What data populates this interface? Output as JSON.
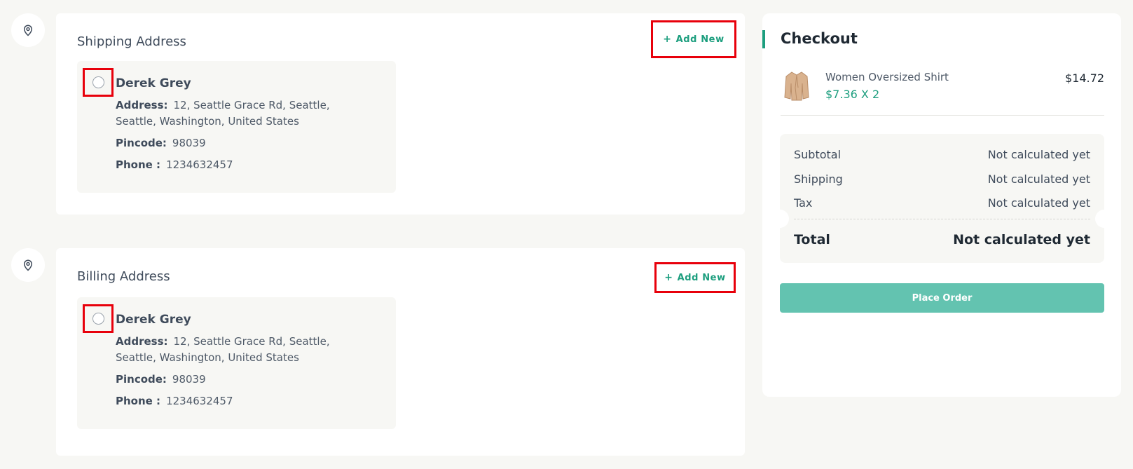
{
  "shipping": {
    "title": "Shipping Address",
    "add_new_label": "Add New",
    "address": {
      "name": "Derek Grey",
      "address_label": "Address:",
      "address_line1": "12, Seattle Grace Rd, Seattle,",
      "address_line2": "Seattle, Washington, United States",
      "pincode_label": "Pincode:",
      "pincode": "98039",
      "phone_label": "Phone :",
      "phone": "1234632457"
    }
  },
  "billing": {
    "title": "Billing Address",
    "add_new_label": "Add New",
    "address": {
      "name": "Derek Grey",
      "address_label": "Address:",
      "address_line1": "12, Seattle Grace Rd, Seattle,",
      "address_line2": "Seattle, Washington, United States",
      "pincode_label": "Pincode:",
      "pincode": "98039",
      "phone_label": "Phone :",
      "phone": "1234632457"
    }
  },
  "checkout": {
    "title": "Checkout",
    "item": {
      "name": "Women Oversized Shirt",
      "price_qty": "$7.36 X 2",
      "total": "$14.72",
      "thumbnail_icon": "shirt-thumbnail"
    },
    "summary": [
      {
        "label": "Subtotal",
        "value": "Not calculated yet"
      },
      {
        "label": "Shipping",
        "value": "Not calculated yet"
      },
      {
        "label": "Tax",
        "value": "Not calculated yet"
      }
    ],
    "total_label": "Total",
    "total_value": "Not calculated yet",
    "place_order_label": "Place Order"
  },
  "colors": {
    "accent": "#1c9e7e",
    "button": "#63c3b0",
    "highlight": "#e8000b",
    "background": "#f7f7f4"
  }
}
